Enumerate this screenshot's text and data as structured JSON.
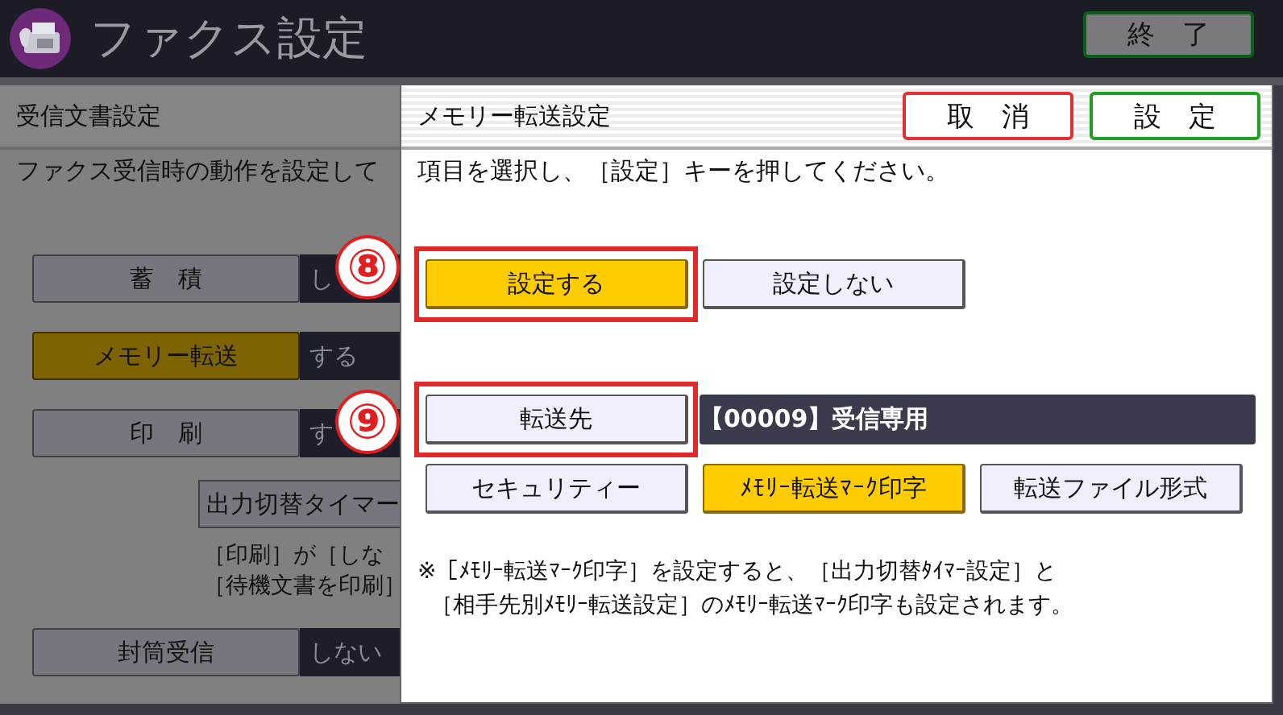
{
  "header": {
    "title": "ファクス設定",
    "exit_button": "終　了"
  },
  "background_panel": {
    "title": "受信文書設定",
    "description": "ファクス受信時の動作を設定して",
    "settings": [
      {
        "label": "蓄　積",
        "value": "し",
        "selected": false,
        "marker": "⑧"
      },
      {
        "label": "メモリー転送",
        "value": "する",
        "selected": true
      },
      {
        "label": "印　刷",
        "value": "す",
        "selected": false,
        "marker": "⑨"
      }
    ],
    "timer_button": "出力切替タイマー",
    "notes": [
      "［印刷］が［しな",
      "［待機文書を印刷］"
    ],
    "envelope": {
      "label": "封筒受信",
      "value": "しない",
      "selected": false
    }
  },
  "dialog": {
    "title": "メモリー転送設定",
    "cancel_button": "取　消",
    "ok_button": "設　定",
    "instruction": "項目を選択し、［設定］キーを押してください。",
    "mode_options": [
      {
        "label": "設定する",
        "selected": true,
        "highlighted": true
      },
      {
        "label": "設定しない",
        "selected": false,
        "highlighted": false
      }
    ],
    "destination_button": "転送先",
    "destination_highlighted": true,
    "destination": "【00009】受信専用",
    "options": [
      {
        "label": "セキュリティー",
        "selected": false
      },
      {
        "label": "ﾒﾓﾘｰ転送ﾏｰｸ印字",
        "selected": true
      },
      {
        "label": "転送ファイル形式",
        "selected": false
      }
    ],
    "notes": [
      "※［ﾒﾓﾘｰ転送ﾏｰｸ印字］を設定すると、［出力切替ﾀｲﾏｰ設定］と",
      "［相手先別ﾒﾓﾘｰ転送設定］のﾒﾓﾘｰ転送ﾏｰｸ印字も設定されます。"
    ]
  }
}
